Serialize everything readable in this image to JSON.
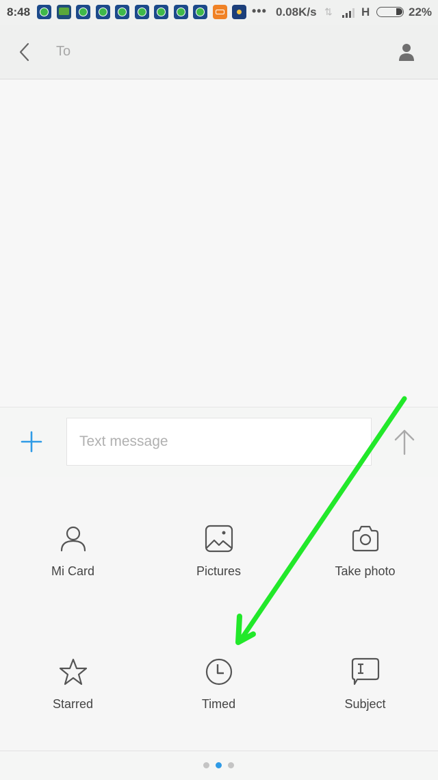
{
  "status_bar": {
    "time": "8:48",
    "notifications": [
      "whatsapp-icon",
      "message-icon",
      "whatsapp-icon",
      "whatsapp-icon",
      "whatsapp-icon",
      "whatsapp-icon",
      "whatsapp-icon",
      "whatsapp-icon",
      "whatsapp-icon",
      "miui-icon",
      "weather-icon"
    ],
    "overflow": "•••",
    "net_speed": "0.08K/s",
    "network_type": "H",
    "battery_percent": "22%",
    "battery_level": 0.22
  },
  "header": {
    "back_icon": "chevron-left-icon",
    "to_placeholder": "To",
    "contact_icon": "person-icon"
  },
  "composer": {
    "add_icon": "plus-icon",
    "message_placeholder": "Text message",
    "message_value": "",
    "send_icon": "arrow-up-icon"
  },
  "attachments": [
    {
      "label": "Mi Card",
      "icon": "person-outline-icon"
    },
    {
      "label": "Pictures",
      "icon": "image-icon"
    },
    {
      "label": "Take photo",
      "icon": "camera-icon"
    },
    {
      "label": "Starred",
      "icon": "star-icon"
    },
    {
      "label": "Timed",
      "icon": "clock-icon"
    },
    {
      "label": "Subject",
      "icon": "subject-icon"
    }
  ],
  "pager": {
    "pages": 3,
    "active_index": 1
  },
  "colors": {
    "accent": "#2f9be6",
    "icon_gray": "#555555",
    "annotation_arrow": "#22e82a",
    "dot_inactive": "#c4c4c4"
  },
  "annotation": {
    "type": "arrow",
    "points_to": "Timed"
  }
}
